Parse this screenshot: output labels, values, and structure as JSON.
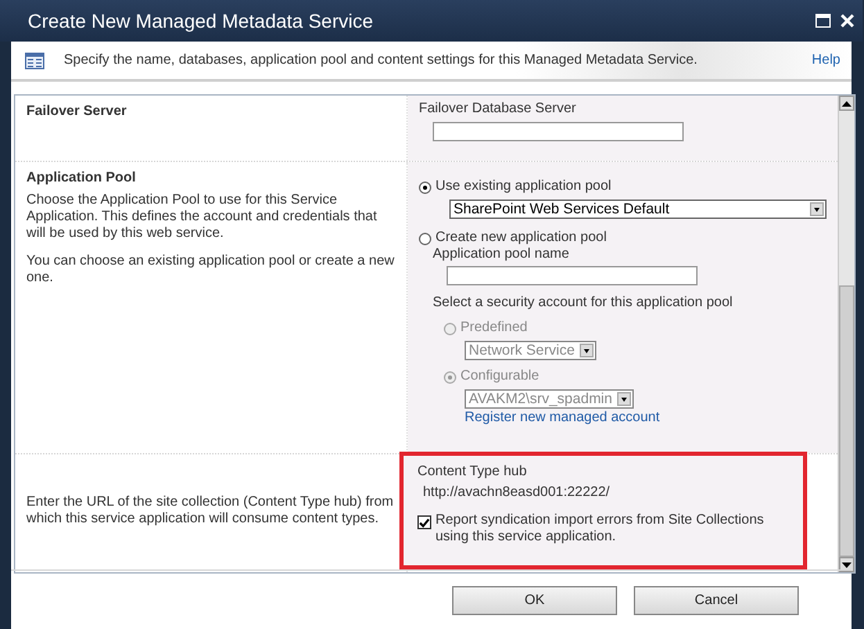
{
  "window": {
    "title": "Create New Managed Metadata Service"
  },
  "header": {
    "description": "Specify the name, databases, application pool and content settings for this Managed Metadata Service.",
    "help_link": "Help"
  },
  "failover": {
    "title": "Failover Server",
    "field_label": "Failover Database Server"
  },
  "application_pool": {
    "title": "Application Pool",
    "paragraphs": [
      "Choose the Application Pool to use for this Service Application.  This defines the account and credentials that will be used by this web service.",
      "You can choose an existing application pool or create a new one."
    ],
    "options": [
      {
        "label": "Use existing application pool",
        "selected": true,
        "dropdown": "SharePoint Web Services Default"
      },
      {
        "label": "Create new application pool",
        "selected": false
      }
    ],
    "pool_name_label": "Application pool name",
    "security_label": "Select a security account for this application pool",
    "accounts": [
      {
        "label": "Predefined",
        "selected": false,
        "disabled": true,
        "dropdown": "Network Service"
      },
      {
        "label": "Configurable",
        "selected": true,
        "disabled": true,
        "dropdown": "AVAKM2\\srv_spadmin"
      }
    ],
    "register_link": "Register new managed account"
  },
  "content_type_hub": {
    "description": "Enter the URL of the site collection (Content Type hub) from which this service application will consume content types.",
    "highlighted": true,
    "label": "Content Type hub",
    "url": "http://avachn8easd001:22222/",
    "report_errors": {
      "label": "Report syndication import errors from Site Collections using this service application.",
      "checked": true
    }
  },
  "buttons": [
    {
      "label": "OK"
    },
    {
      "label": "Cancel"
    }
  ]
}
